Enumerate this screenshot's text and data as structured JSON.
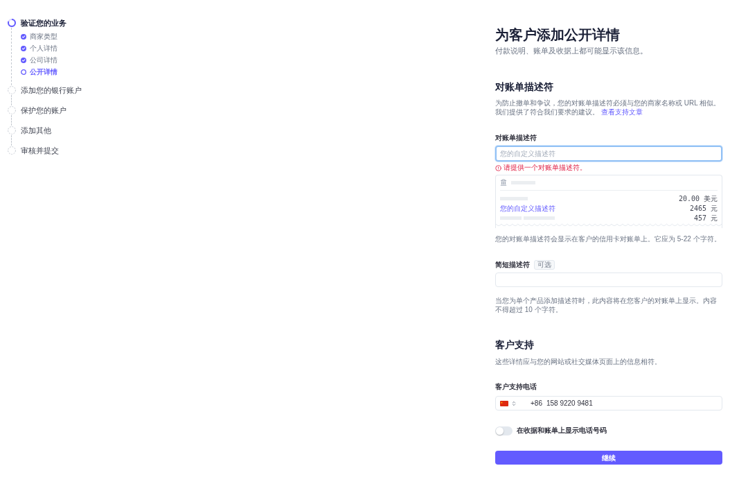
{
  "sidebar": {
    "steps": [
      {
        "label": "验证您的业务",
        "completed": false,
        "selected": true,
        "children": [
          {
            "label": "商家类型",
            "completed": true,
            "selected": false
          },
          {
            "label": "个人详情",
            "completed": true,
            "selected": false
          },
          {
            "label": "公司详情",
            "completed": true,
            "selected": false
          },
          {
            "label": "公开详情",
            "completed": false,
            "selected": true
          }
        ]
      },
      {
        "label": "添加您的银行账户",
        "completed": false,
        "selected": false
      },
      {
        "label": "保护您的账户",
        "completed": false,
        "selected": false
      },
      {
        "label": "添加其他",
        "completed": false,
        "selected": false
      },
      {
        "label": "审核并提交",
        "completed": false,
        "selected": false
      }
    ]
  },
  "page": {
    "title": "为客户添加公开详情",
    "subtitle": "付款说明、账单及收据上都可能显示该信息。"
  },
  "statement_descriptor": {
    "heading": "对账单描述符",
    "description": "为防止撤单和争议，您的对账单描述符必须与您的商家名称或 URL 相似。我们提供了符合我们要求的建议。",
    "link": "查看支持文章",
    "field": {
      "label": "对账单描述符",
      "placeholder": "您的自定义描述符",
      "focused": true,
      "error": "请提供一个对账单描述符。"
    },
    "preview": {
      "rows": [
        {
          "kind": "placeholder",
          "amount": "20.00 美元"
        },
        {
          "kind": "descriptor",
          "description": "您的自定义描述符",
          "amount": "2465 元"
        },
        {
          "kind": "placeholder",
          "amount": "457 元"
        }
      ]
    },
    "help": "您的对账单描述符会显示在客户的信用卡对账单上。它应为 5-22 个字符。"
  },
  "short_descriptor": {
    "label": "简短描述符",
    "badge": "可选",
    "help": "当您为单个产品添加描述符时，此内容将在您客户的对账单上显示。内容不得超过 10 个字符。"
  },
  "customer_support": {
    "heading": "客户支持",
    "description": "这些详情应与您的网站或社交媒体页面上的信息相符。",
    "phone": {
      "label": "客户支持电话",
      "country_code": "+86",
      "value": "158 9220 9481"
    },
    "toggle": {
      "label": "在收据和账单上显示电话号码",
      "on": false
    }
  },
  "continue_button": {
    "label": "继续"
  }
}
